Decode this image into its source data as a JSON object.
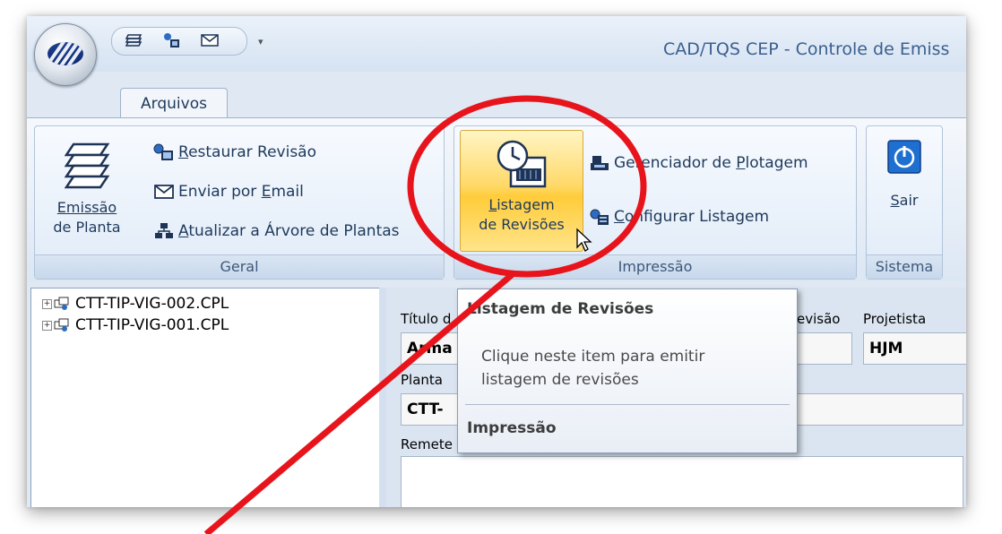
{
  "window": {
    "title": "CAD/TQS CEP - Controle de Emiss"
  },
  "qat": {
    "more_glyph": "▾"
  },
  "tabs": [
    {
      "label": "Arquivos"
    }
  ],
  "ribbon": {
    "geral": {
      "label": "Geral",
      "emissao_line1": "Emissão",
      "emissao_line2": "de Planta",
      "restaurar_first": "R",
      "restaurar_rest": "estaurar Revisão",
      "enviar_prefix": "Enviar por ",
      "enviar_first": "E",
      "enviar_rest": "mail",
      "atualizar_first": "A",
      "atualizar_rest": "tualizar a Árvore de Plantas"
    },
    "impressao": {
      "label": "Impressão",
      "listagem_first": "L",
      "listagem_rest": "istagem",
      "listagem_line2": "de Revisões",
      "gerenciador_head": "Gerenciador de ",
      "gerenciador_first": "P",
      "gerenciador_rest": "lotagem",
      "configurar_head": "C",
      "configurar_rest": "onfigurar Listagem"
    },
    "sistema": {
      "label": "Sistema",
      "sair_first": "S",
      "sair_rest": "air"
    }
  },
  "tree": {
    "items": [
      {
        "label": "CTT-TIP-VIG-002.CPL",
        "expander": "+"
      },
      {
        "label": "CTT-TIP-VIG-001.CPL",
        "expander": "+"
      }
    ]
  },
  "form": {
    "titulo_label": "Título d",
    "titulo_value": "Arma",
    "revisao_label": "evisão",
    "projetista_label": "Projetista",
    "projetista_value": "HJM",
    "planta_label": "Planta",
    "planta_value": "CTT-",
    "remetente_label": "Remete"
  },
  "tooltip": {
    "title": "Listagem de Revisões",
    "body": "Clique neste item para emitir listagem de revisões",
    "footer": "Impressão"
  },
  "colors": {
    "annotation": "#e8141b",
    "highlight": "#ffd14a",
    "accent": "#1e395b"
  }
}
